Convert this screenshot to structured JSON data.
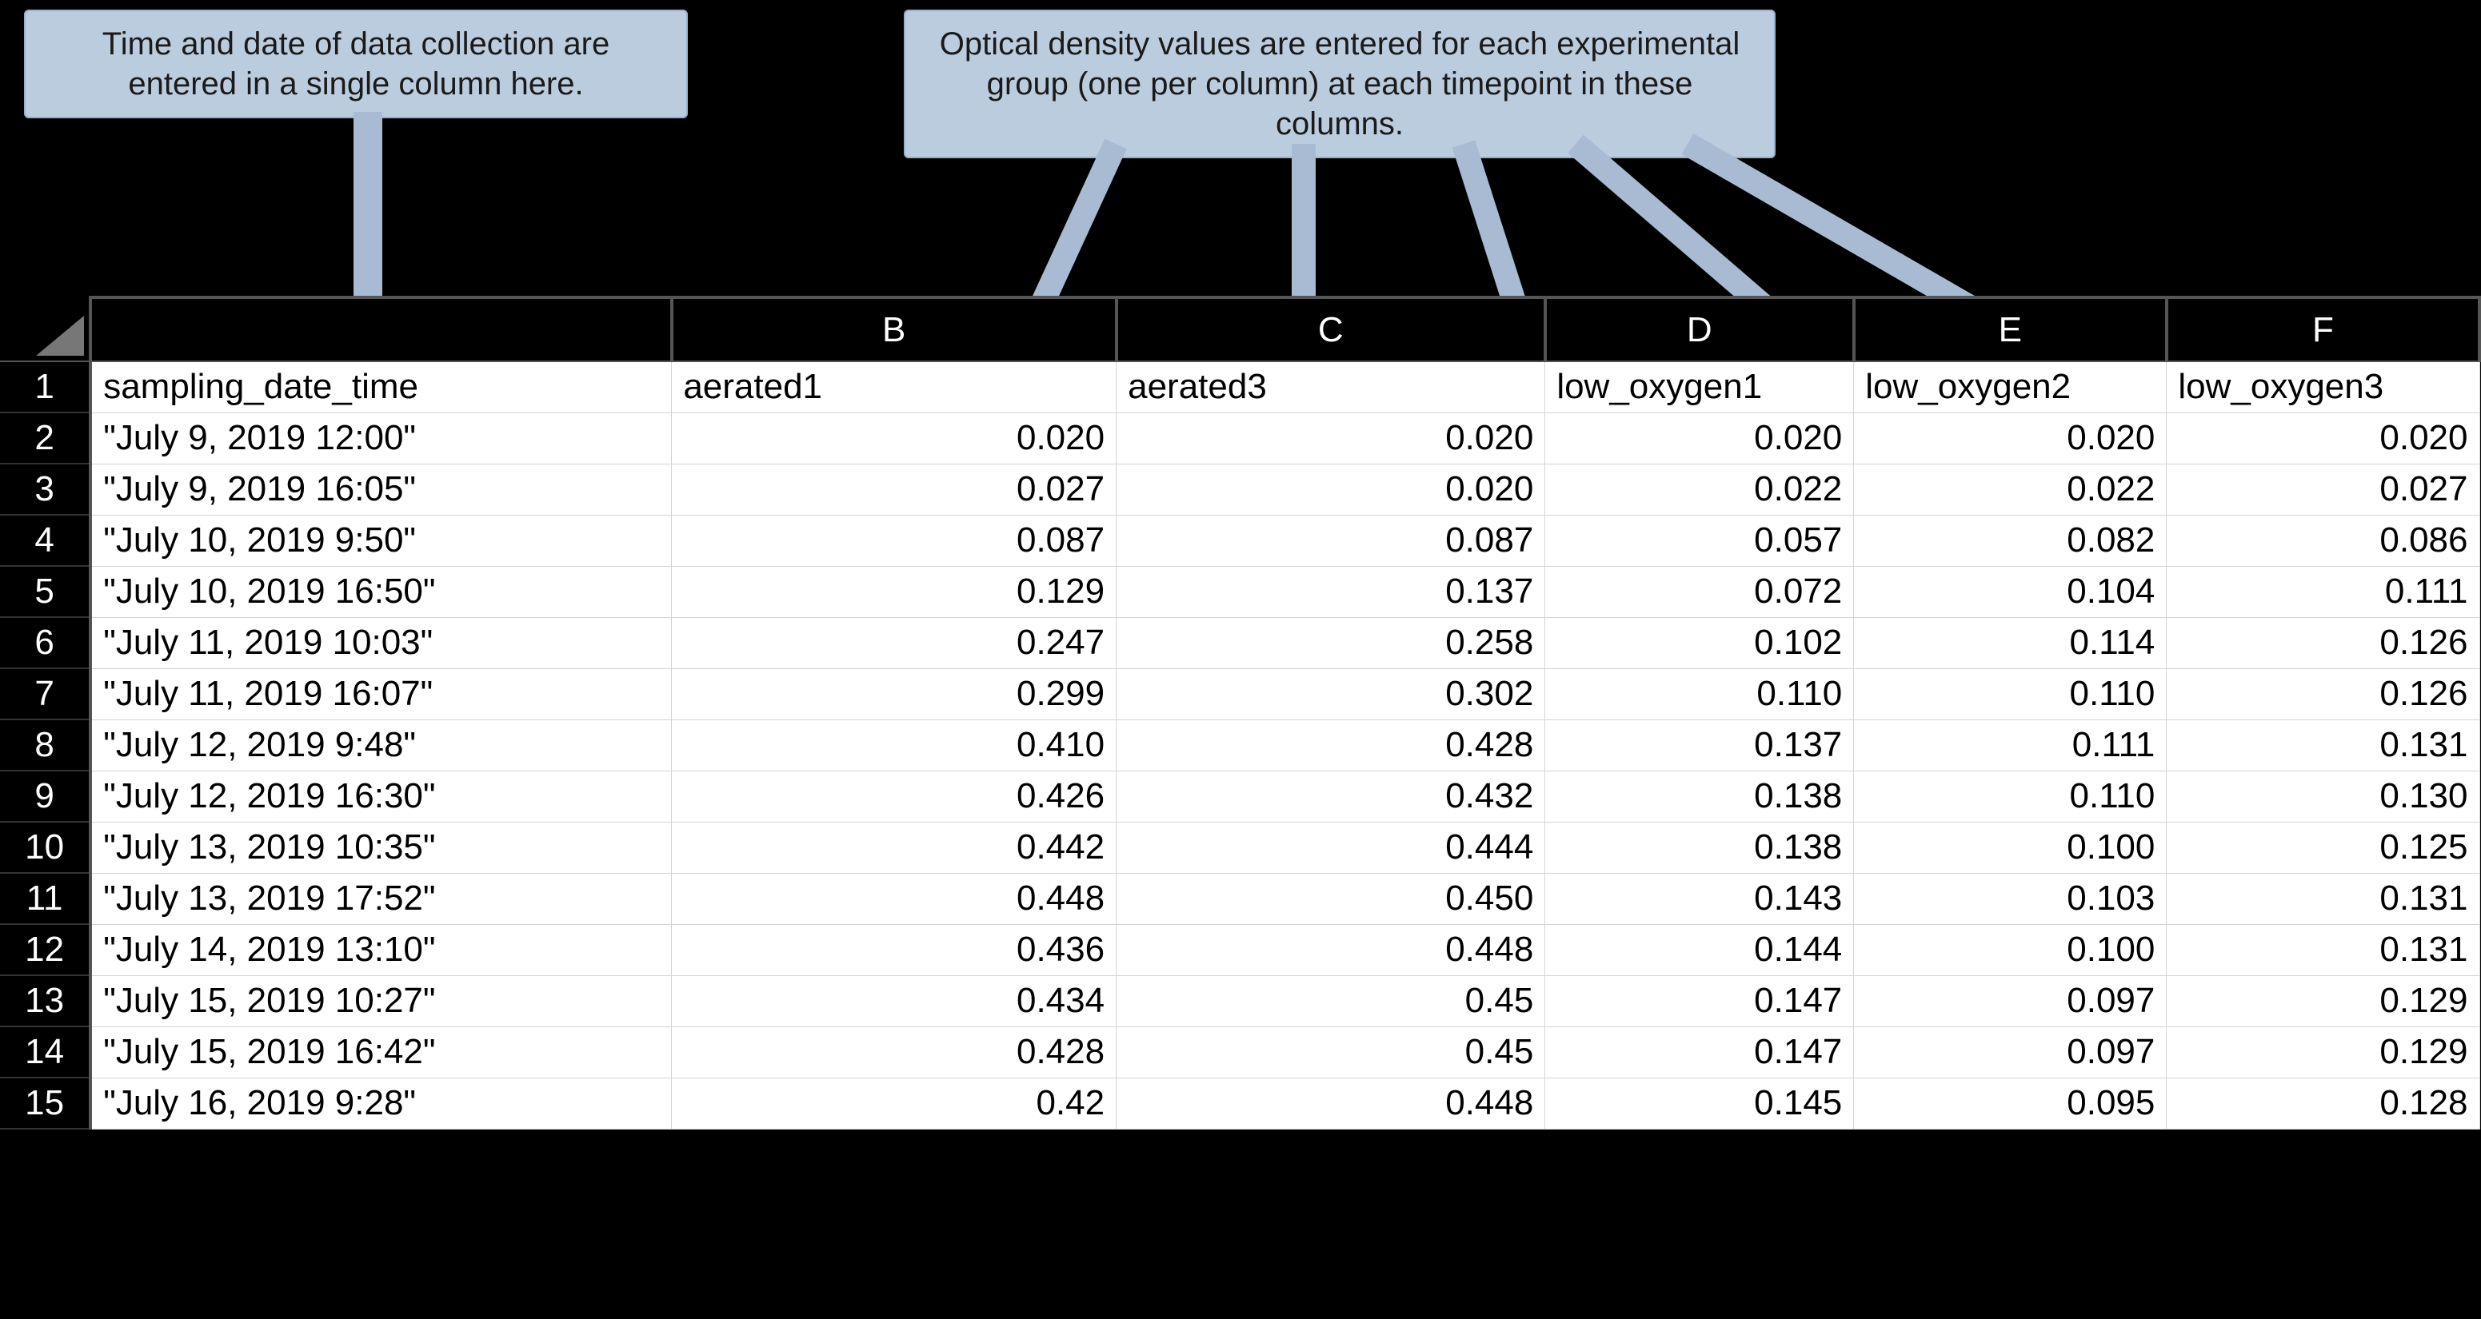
{
  "callouts": {
    "left": "Time and date of data collection are entered in a single column here.",
    "right": "Optical density values are entered for each experimental group (one per column) at each timepoint in these columns."
  },
  "columnLetters": [
    "",
    "B",
    "C",
    "D",
    "E",
    "F"
  ],
  "rowNumbers": [
    "1",
    "2",
    "3",
    "4",
    "5",
    "6",
    "7",
    "8",
    "9",
    "10",
    "11",
    "12",
    "13",
    "14",
    "15"
  ],
  "headerRow": [
    "sampling_date_time",
    "aerated1",
    "aerated3",
    "low_oxygen1",
    "low_oxygen2",
    "low_oxygen3"
  ],
  "dataRows": [
    [
      "\"July 9, 2019  12:00\"",
      "0.020",
      "0.020",
      "0.020",
      "0.020",
      "0.020"
    ],
    [
      "\"July 9, 2019 16:05\"",
      "0.027",
      "0.020",
      "0.022",
      "0.022",
      "0.027"
    ],
    [
      "\"July 10, 2019 9:50\"",
      "0.087",
      "0.087",
      "0.057",
      "0.082",
      "0.086"
    ],
    [
      "\"July 10, 2019 16:50\"",
      "0.129",
      "0.137",
      "0.072",
      "0.104",
      "0.111"
    ],
    [
      "\"July 11, 2019 10:03\"",
      "0.247",
      "0.258",
      "0.102",
      "0.114",
      "0.126"
    ],
    [
      "\"July 11, 2019 16:07\"",
      "0.299",
      "0.302",
      "0.110",
      "0.110",
      "0.126"
    ],
    [
      "\"July 12, 2019 9:48\"",
      "0.410",
      "0.428",
      "0.137",
      "0.111",
      "0.131"
    ],
    [
      "\"July 12, 2019 16:30\"",
      "0.426",
      "0.432",
      "0.138",
      "0.110",
      "0.130"
    ],
    [
      "\"July 13, 2019 10:35\"",
      "0.442",
      "0.444",
      "0.138",
      "0.100",
      "0.125"
    ],
    [
      "\"July 13, 2019 17:52\"",
      "0.448",
      "0.450",
      "0.143",
      "0.103",
      "0.131"
    ],
    [
      "\"July 14, 2019 13:10\"",
      "0.436",
      "0.448",
      "0.144",
      "0.100",
      "0.131"
    ],
    [
      "\"July 15, 2019 10:27\"",
      "0.434",
      "0.45",
      "0.147",
      "0.097",
      "0.129"
    ],
    [
      "\"July 15, 2019 16:42\"",
      "0.428",
      "0.45",
      "0.147",
      "0.097",
      "0.129"
    ],
    [
      "\"July 16, 2019 9:28\"",
      "0.42",
      "0.448",
      "0.145",
      "0.095",
      "0.128"
    ]
  ],
  "chart_data": {
    "type": "table",
    "title": "Spreadsheet of optical density measurements over time for aerated and low-oxygen experimental groups",
    "columns": [
      "sampling_date_time",
      "aerated1",
      "aerated3",
      "low_oxygen1",
      "low_oxygen2",
      "low_oxygen3"
    ],
    "rows": [
      [
        "July 9, 2019  12:00",
        0.02,
        0.02,
        0.02,
        0.02,
        0.02
      ],
      [
        "July 9, 2019 16:05",
        0.027,
        0.02,
        0.022,
        0.022,
        0.027
      ],
      [
        "July 10, 2019 9:50",
        0.087,
        0.087,
        0.057,
        0.082,
        0.086
      ],
      [
        "July 10, 2019 16:50",
        0.129,
        0.137,
        0.072,
        0.104,
        0.111
      ],
      [
        "July 11, 2019 10:03",
        0.247,
        0.258,
        0.102,
        0.114,
        0.126
      ],
      [
        "July 11, 2019 16:07",
        0.299,
        0.302,
        0.11,
        0.11,
        0.126
      ],
      [
        "July 12, 2019 9:48",
        0.41,
        0.428,
        0.137,
        0.111,
        0.131
      ],
      [
        "July 12, 2019 16:30",
        0.426,
        0.432,
        0.138,
        0.11,
        0.13
      ],
      [
        "July 13, 2019 10:35",
        0.442,
        0.444,
        0.138,
        0.1,
        0.125
      ],
      [
        "July 13, 2019 17:52",
        0.448,
        0.45,
        0.143,
        0.103,
        0.131
      ],
      [
        "July 14, 2019 13:10",
        0.436,
        0.448,
        0.144,
        0.1,
        0.131
      ],
      [
        "July 15, 2019 10:27",
        0.434,
        0.45,
        0.147,
        0.097,
        0.129
      ],
      [
        "July 15, 2019 16:42",
        0.428,
        0.45,
        0.147,
        0.097,
        0.129
      ],
      [
        "July 16, 2019 9:28",
        0.42,
        0.448,
        0.145,
        0.095,
        0.128
      ]
    ]
  }
}
